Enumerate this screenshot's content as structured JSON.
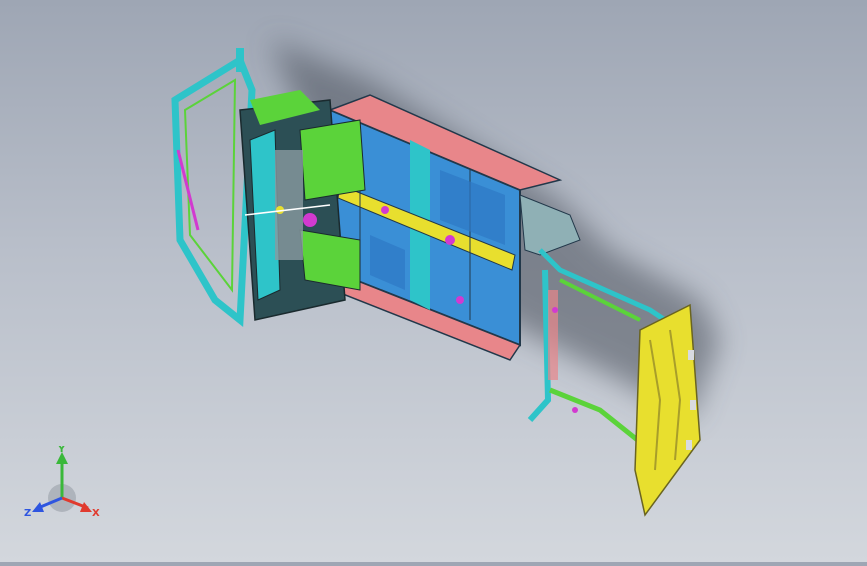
{
  "viewport": {
    "background_top": "#9ea6b4",
    "background_bottom": "#d3d7dd",
    "model_colors": {
      "pink": "#e8868a",
      "blue": "#3a8fd6",
      "cyan": "#2ec4c9",
      "green": "#5bd33a",
      "yellow": "#e8df2e",
      "magenta": "#d23ad0",
      "dark": "#2c4f55"
    }
  },
  "triad": {
    "x_label": "X",
    "y_label": "Y",
    "z_label": "Z",
    "x_color": "#e03a2e",
    "y_color": "#3ab83a",
    "z_color": "#2e55e0"
  }
}
